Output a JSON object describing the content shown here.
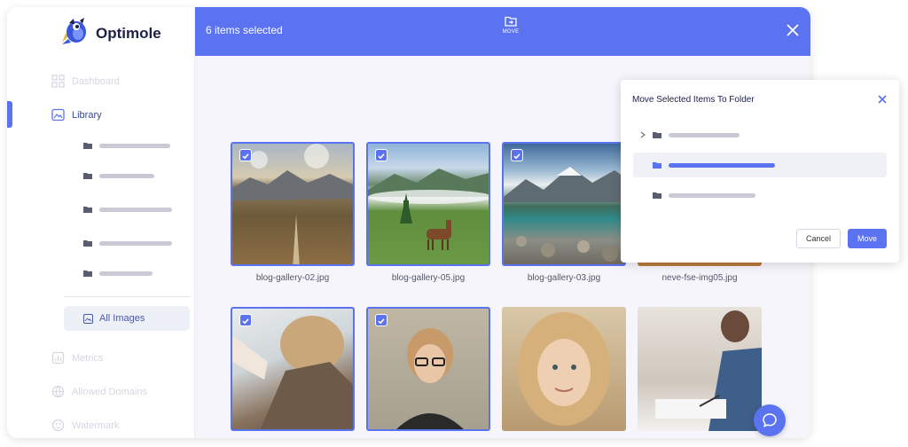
{
  "app": {
    "name": "Optimole"
  },
  "sidebar": {
    "items": [
      {
        "label": "Dashboard",
        "icon": "dashboard-icon"
      },
      {
        "label": "Library",
        "icon": "library-icon",
        "active": true
      },
      {
        "label": "Metrics",
        "icon": "metrics-icon"
      },
      {
        "label": "Allowed Domains",
        "icon": "allowed-domains-icon"
      },
      {
        "label": "Watermark",
        "icon": "watermark-icon"
      }
    ],
    "all_images_label": "All Images"
  },
  "topbar": {
    "selected_text": "6 items selected",
    "move_label": "MOVE"
  },
  "grid": {
    "items": [
      {
        "caption": "blog-gallery-02.jpg",
        "selected": true
      },
      {
        "caption": "blog-gallery-05.jpg",
        "selected": true
      },
      {
        "caption": "blog-gallery-03.jpg",
        "selected": true
      },
      {
        "caption": "neve-fse-img05.jpg",
        "selected": false
      },
      {
        "caption": "",
        "selected": true
      },
      {
        "caption": "",
        "selected": true
      },
      {
        "caption": "",
        "selected": false
      },
      {
        "caption": "",
        "selected": false
      }
    ]
  },
  "move_dialog": {
    "title": "Move Selected Items To Folder",
    "cancel_label": "Cancel",
    "move_label": "Move"
  },
  "colors": {
    "accent": "#5b73f0",
    "sidebar_text": "#3b4a8b"
  },
  "icons": {
    "folder": "folder-icon",
    "check": "check-icon",
    "close": "close-icon",
    "help": "chat-help-icon"
  }
}
